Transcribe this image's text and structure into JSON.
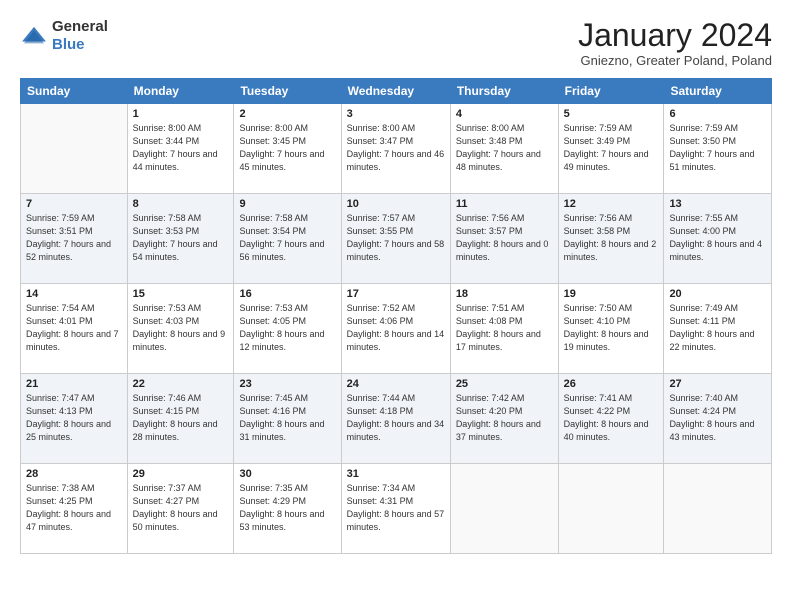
{
  "header": {
    "logo_general": "General",
    "logo_blue": "Blue",
    "title": "January 2024",
    "location": "Gniezno, Greater Poland, Poland"
  },
  "days_of_week": [
    "Sunday",
    "Monday",
    "Tuesday",
    "Wednesday",
    "Thursday",
    "Friday",
    "Saturday"
  ],
  "weeks": [
    [
      {
        "day": "",
        "sunrise": "",
        "sunset": "",
        "daylight": ""
      },
      {
        "day": "1",
        "sunrise": "Sunrise: 8:00 AM",
        "sunset": "Sunset: 3:44 PM",
        "daylight": "Daylight: 7 hours and 44 minutes."
      },
      {
        "day": "2",
        "sunrise": "Sunrise: 8:00 AM",
        "sunset": "Sunset: 3:45 PM",
        "daylight": "Daylight: 7 hours and 45 minutes."
      },
      {
        "day": "3",
        "sunrise": "Sunrise: 8:00 AM",
        "sunset": "Sunset: 3:47 PM",
        "daylight": "Daylight: 7 hours and 46 minutes."
      },
      {
        "day": "4",
        "sunrise": "Sunrise: 8:00 AM",
        "sunset": "Sunset: 3:48 PM",
        "daylight": "Daylight: 7 hours and 48 minutes."
      },
      {
        "day": "5",
        "sunrise": "Sunrise: 7:59 AM",
        "sunset": "Sunset: 3:49 PM",
        "daylight": "Daylight: 7 hours and 49 minutes."
      },
      {
        "day": "6",
        "sunrise": "Sunrise: 7:59 AM",
        "sunset": "Sunset: 3:50 PM",
        "daylight": "Daylight: 7 hours and 51 minutes."
      }
    ],
    [
      {
        "day": "7",
        "sunrise": "Sunrise: 7:59 AM",
        "sunset": "Sunset: 3:51 PM",
        "daylight": "Daylight: 7 hours and 52 minutes."
      },
      {
        "day": "8",
        "sunrise": "Sunrise: 7:58 AM",
        "sunset": "Sunset: 3:53 PM",
        "daylight": "Daylight: 7 hours and 54 minutes."
      },
      {
        "day": "9",
        "sunrise": "Sunrise: 7:58 AM",
        "sunset": "Sunset: 3:54 PM",
        "daylight": "Daylight: 7 hours and 56 minutes."
      },
      {
        "day": "10",
        "sunrise": "Sunrise: 7:57 AM",
        "sunset": "Sunset: 3:55 PM",
        "daylight": "Daylight: 7 hours and 58 minutes."
      },
      {
        "day": "11",
        "sunrise": "Sunrise: 7:56 AM",
        "sunset": "Sunset: 3:57 PM",
        "daylight": "Daylight: 8 hours and 0 minutes."
      },
      {
        "day": "12",
        "sunrise": "Sunrise: 7:56 AM",
        "sunset": "Sunset: 3:58 PM",
        "daylight": "Daylight: 8 hours and 2 minutes."
      },
      {
        "day": "13",
        "sunrise": "Sunrise: 7:55 AM",
        "sunset": "Sunset: 4:00 PM",
        "daylight": "Daylight: 8 hours and 4 minutes."
      }
    ],
    [
      {
        "day": "14",
        "sunrise": "Sunrise: 7:54 AM",
        "sunset": "Sunset: 4:01 PM",
        "daylight": "Daylight: 8 hours and 7 minutes."
      },
      {
        "day": "15",
        "sunrise": "Sunrise: 7:53 AM",
        "sunset": "Sunset: 4:03 PM",
        "daylight": "Daylight: 8 hours and 9 minutes."
      },
      {
        "day": "16",
        "sunrise": "Sunrise: 7:53 AM",
        "sunset": "Sunset: 4:05 PM",
        "daylight": "Daylight: 8 hours and 12 minutes."
      },
      {
        "day": "17",
        "sunrise": "Sunrise: 7:52 AM",
        "sunset": "Sunset: 4:06 PM",
        "daylight": "Daylight: 8 hours and 14 minutes."
      },
      {
        "day": "18",
        "sunrise": "Sunrise: 7:51 AM",
        "sunset": "Sunset: 4:08 PM",
        "daylight": "Daylight: 8 hours and 17 minutes."
      },
      {
        "day": "19",
        "sunrise": "Sunrise: 7:50 AM",
        "sunset": "Sunset: 4:10 PM",
        "daylight": "Daylight: 8 hours and 19 minutes."
      },
      {
        "day": "20",
        "sunrise": "Sunrise: 7:49 AM",
        "sunset": "Sunset: 4:11 PM",
        "daylight": "Daylight: 8 hours and 22 minutes."
      }
    ],
    [
      {
        "day": "21",
        "sunrise": "Sunrise: 7:47 AM",
        "sunset": "Sunset: 4:13 PM",
        "daylight": "Daylight: 8 hours and 25 minutes."
      },
      {
        "day": "22",
        "sunrise": "Sunrise: 7:46 AM",
        "sunset": "Sunset: 4:15 PM",
        "daylight": "Daylight: 8 hours and 28 minutes."
      },
      {
        "day": "23",
        "sunrise": "Sunrise: 7:45 AM",
        "sunset": "Sunset: 4:16 PM",
        "daylight": "Daylight: 8 hours and 31 minutes."
      },
      {
        "day": "24",
        "sunrise": "Sunrise: 7:44 AM",
        "sunset": "Sunset: 4:18 PM",
        "daylight": "Daylight: 8 hours and 34 minutes."
      },
      {
        "day": "25",
        "sunrise": "Sunrise: 7:42 AM",
        "sunset": "Sunset: 4:20 PM",
        "daylight": "Daylight: 8 hours and 37 minutes."
      },
      {
        "day": "26",
        "sunrise": "Sunrise: 7:41 AM",
        "sunset": "Sunset: 4:22 PM",
        "daylight": "Daylight: 8 hours and 40 minutes."
      },
      {
        "day": "27",
        "sunrise": "Sunrise: 7:40 AM",
        "sunset": "Sunset: 4:24 PM",
        "daylight": "Daylight: 8 hours and 43 minutes."
      }
    ],
    [
      {
        "day": "28",
        "sunrise": "Sunrise: 7:38 AM",
        "sunset": "Sunset: 4:25 PM",
        "daylight": "Daylight: 8 hours and 47 minutes."
      },
      {
        "day": "29",
        "sunrise": "Sunrise: 7:37 AM",
        "sunset": "Sunset: 4:27 PM",
        "daylight": "Daylight: 8 hours and 50 minutes."
      },
      {
        "day": "30",
        "sunrise": "Sunrise: 7:35 AM",
        "sunset": "Sunset: 4:29 PM",
        "daylight": "Daylight: 8 hours and 53 minutes."
      },
      {
        "day": "31",
        "sunrise": "Sunrise: 7:34 AM",
        "sunset": "Sunset: 4:31 PM",
        "daylight": "Daylight: 8 hours and 57 minutes."
      },
      {
        "day": "",
        "sunrise": "",
        "sunset": "",
        "daylight": ""
      },
      {
        "day": "",
        "sunrise": "",
        "sunset": "",
        "daylight": ""
      },
      {
        "day": "",
        "sunrise": "",
        "sunset": "",
        "daylight": ""
      }
    ]
  ]
}
